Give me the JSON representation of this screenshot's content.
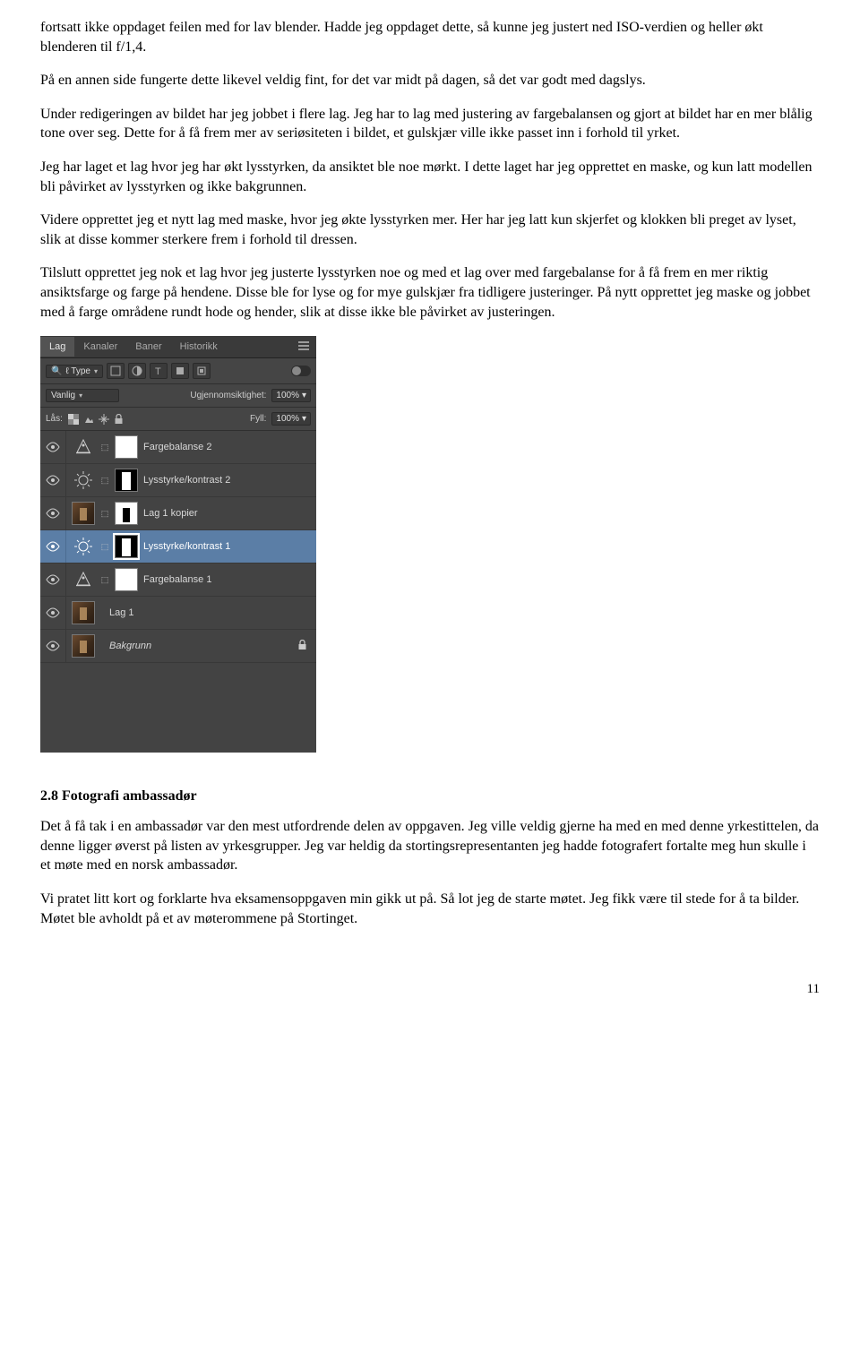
{
  "paragraphs": {
    "p1": "fortsatt ikke oppdaget feilen med for lav blender. Hadde jeg oppdaget dette, så kunne jeg justert ned ISO-verdien og heller økt blenderen til f/1,4.",
    "p2": "På en annen side fungerte dette likevel veldig fint, for det var midt på dagen, så det var godt med dagslys.",
    "p3": "Under redigeringen av bildet har jeg jobbet i flere lag. Jeg har to lag med justering av fargebalansen og gjort at bildet har en mer blålig tone over seg. Dette for å få frem mer av seriøsiteten i bildet, et gulskjær ville ikke passet inn i forhold til yrket.",
    "p4": "Jeg har laget et lag hvor jeg har økt lysstyrken, da ansiktet ble noe mørkt. I dette laget har jeg opprettet en maske, og kun latt modellen bli påvirket av lysstyrken og ikke bakgrunnen.",
    "p5": "Videre opprettet jeg et nytt lag med maske, hvor jeg økte lysstyrken mer. Her har jeg latt kun skjerfet og klokken bli preget av lyset, slik at disse kommer sterkere frem i forhold til dressen.",
    "p6": "Tilslutt opprettet jeg nok et lag hvor jeg justerte lysstyrken noe og med et lag over med fargebalanse for å få frem en mer riktig ansiktsfarge og farge på hendene. Disse ble for lyse og for mye gulskjær fra tidligere justeringer. På nytt opprettet jeg maske og jobbet med å farge områdene rundt hode og hender, slik at disse ikke ble påvirket av justeringen."
  },
  "section_heading": "2.8 Fotografi ambassadør",
  "section_paragraphs": {
    "sp1": "Det å få tak i en ambassadør var den mest utfordrende delen av oppgaven. Jeg ville veldig gjerne ha med en med denne yrkestittelen, da denne ligger øverst på listen av yrkesgrupper. Jeg var heldig da stortingsrepresentanten jeg hadde fotografert fortalte meg hun skulle i et møte med en norsk ambassadør.",
    "sp2": "Vi pratet litt kort og forklarte hva eksamensoppgaven min gikk ut på. Så lot jeg de starte møtet. Jeg fikk være til stede for å ta bilder. Møtet ble avholdt på et av møterommene på Stortinget."
  },
  "page_number": "11",
  "ps_panel": {
    "tabs": [
      "Lag",
      "Kanaler",
      "Baner",
      "Historikk"
    ],
    "active_tab_index": 0,
    "filter_label": "ℓ Type",
    "blend_mode": "Vanlig",
    "opacity_label": "Ugjennomsiktighet:",
    "opacity_value": "100%",
    "lock_label": "Lås:",
    "fill_label": "Fyll:",
    "fill_value": "100%",
    "layers": [
      {
        "name": "Fargebalanse 2",
        "type": "adjustment",
        "adj": "balance",
        "mask": "white",
        "selected": false
      },
      {
        "name": "Lysstyrke/kontrast 2",
        "type": "adjustment",
        "adj": "brightness",
        "mask": "black-sil",
        "selected": false
      },
      {
        "name": "Lag 1 kopier",
        "type": "image",
        "mask": "white-sil2",
        "selected": false
      },
      {
        "name": "Lysstyrke/kontrast 1",
        "type": "adjustment",
        "adj": "brightness",
        "mask": "black-sil",
        "selected": true
      },
      {
        "name": "Fargebalanse 1",
        "type": "adjustment",
        "adj": "balance",
        "mask": "white",
        "selected": false
      },
      {
        "name": "Lag 1",
        "type": "image",
        "mask": null,
        "selected": false
      },
      {
        "name": "Bakgrunn",
        "type": "background",
        "mask": null,
        "selected": false,
        "italic": true,
        "locked": true
      }
    ]
  }
}
